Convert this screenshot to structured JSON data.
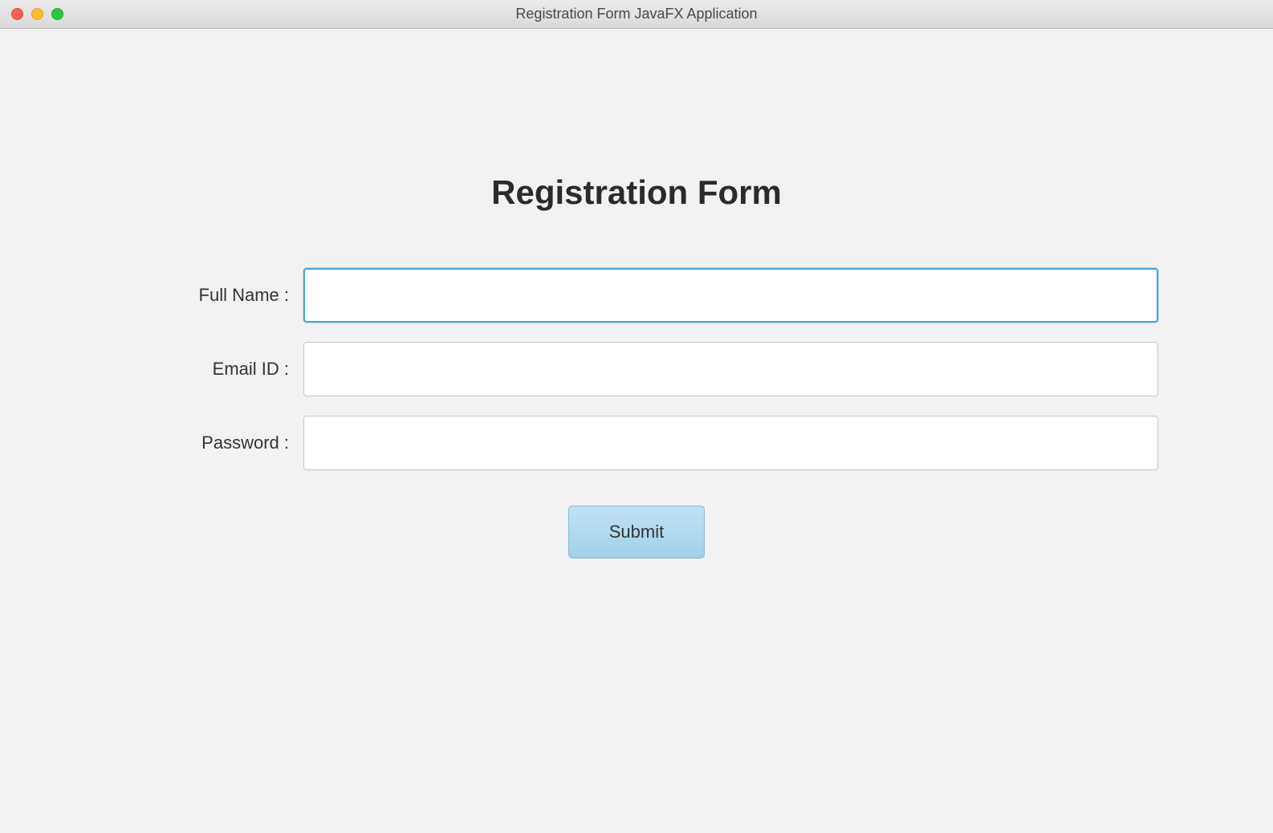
{
  "window": {
    "title": "Registration Form JavaFX Application"
  },
  "form": {
    "heading": "Registration Form",
    "fields": {
      "fullname": {
        "label": "Full Name :",
        "value": ""
      },
      "email": {
        "label": "Email ID :",
        "value": ""
      },
      "password": {
        "label": "Password :",
        "value": ""
      }
    },
    "submit_label": "Submit"
  }
}
